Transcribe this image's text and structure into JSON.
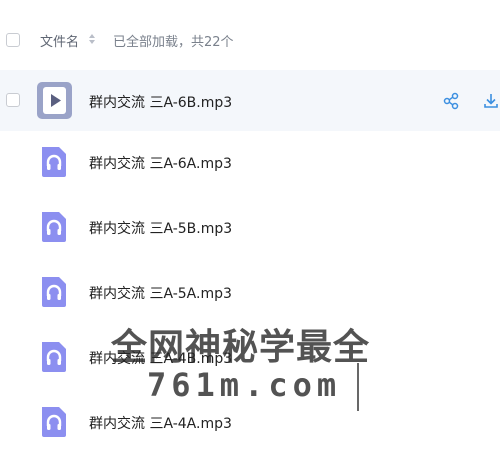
{
  "header": {
    "column_name_label": "文件名",
    "load_status": "已全部加载，共22个"
  },
  "files": [
    {
      "name": "群内交流 三A-6B.mp3",
      "icon": "audio-file-icon",
      "selected_hover": true
    },
    {
      "name": "群内交流 三A-6A.mp3",
      "icon": "audio-file-icon"
    },
    {
      "name": "群内交流 三A-5B.mp3",
      "icon": "audio-file-icon"
    },
    {
      "name": "群内交流 三A-5A.mp3",
      "icon": "audio-file-icon"
    },
    {
      "name": "群内交流 三A-4B.mp3",
      "icon": "audio-file-icon"
    },
    {
      "name": "群内交流 三A-4A.mp3",
      "icon": "audio-file-icon"
    }
  ],
  "row_actions": {
    "share_icon": "share-icon",
    "download_icon": "download-icon"
  },
  "watermark": {
    "line1": "全网神秘学最全",
    "line2": "761m.com"
  },
  "colors": {
    "icon_purple": "#8c8ff0",
    "action_blue": "#3b8fe0",
    "hover_row": "#f4f7fb"
  }
}
